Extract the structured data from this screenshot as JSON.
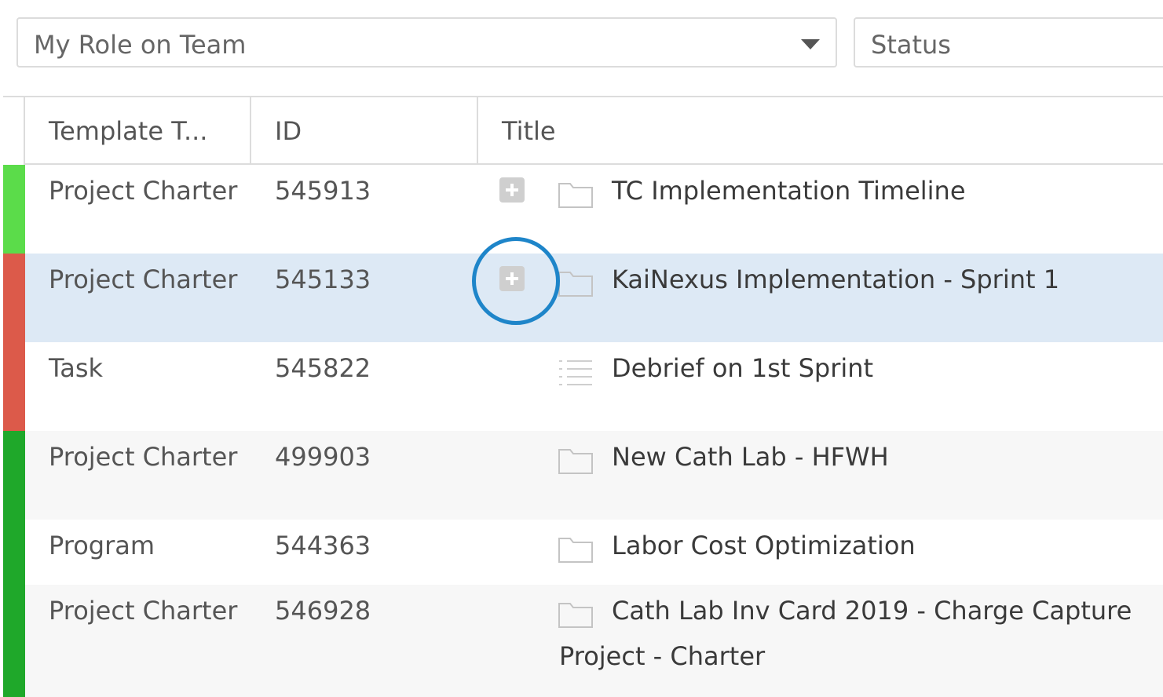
{
  "filters": {
    "role": {
      "value": "My Role on Team"
    },
    "status": {
      "value": "Status"
    }
  },
  "columns": {
    "template_type": "Template T...",
    "id": "ID",
    "title": "Title"
  },
  "rows": [
    {
      "template_type": "Project Charter",
      "id": "545913",
      "title": "TC Implementation Timeline",
      "title_cont": "",
      "icon": "folder-icon",
      "expandable": true,
      "status_color": "#5bdc4a",
      "bg": "#ffffff"
    },
    {
      "template_type": "Project Charter",
      "id": "545133",
      "title": "KaiNexus Implementation - Sprint 1",
      "title_cont": "",
      "icon": "folder-icon",
      "expandable": true,
      "status_color": "#dc5a4a",
      "bg": "#dde9f5"
    },
    {
      "template_type": "Task",
      "id": "545822",
      "title": "Debrief on 1st Sprint",
      "title_cont": "",
      "icon": "task-list-icon",
      "expandable": false,
      "status_color": "#dc5a4a",
      "bg": "#ffffff"
    },
    {
      "template_type": "Project Charter",
      "id": "499903",
      "title": "New Cath Lab - HFWH",
      "title_cont": "",
      "icon": "folder-icon",
      "expandable": false,
      "status_color": "#1fa82a",
      "bg": "#f7f7f7"
    },
    {
      "template_type": "Program",
      "id": "544363",
      "title": "Labor Cost Optimization",
      "title_cont": "",
      "icon": "folder-icon",
      "expandable": false,
      "status_color": "#1fa82a",
      "bg": "#ffffff"
    },
    {
      "template_type": "Project Charter",
      "id": "546928",
      "title": "Cath Lab Inv Card 2019 - Charge Capture",
      "title_cont": "Project - Charter",
      "icon": "folder-icon",
      "expandable": false,
      "status_color": "#1fa82a",
      "bg": "#f7f7f7"
    }
  ],
  "annotation": {
    "highlight_color": "#1e85c9"
  }
}
